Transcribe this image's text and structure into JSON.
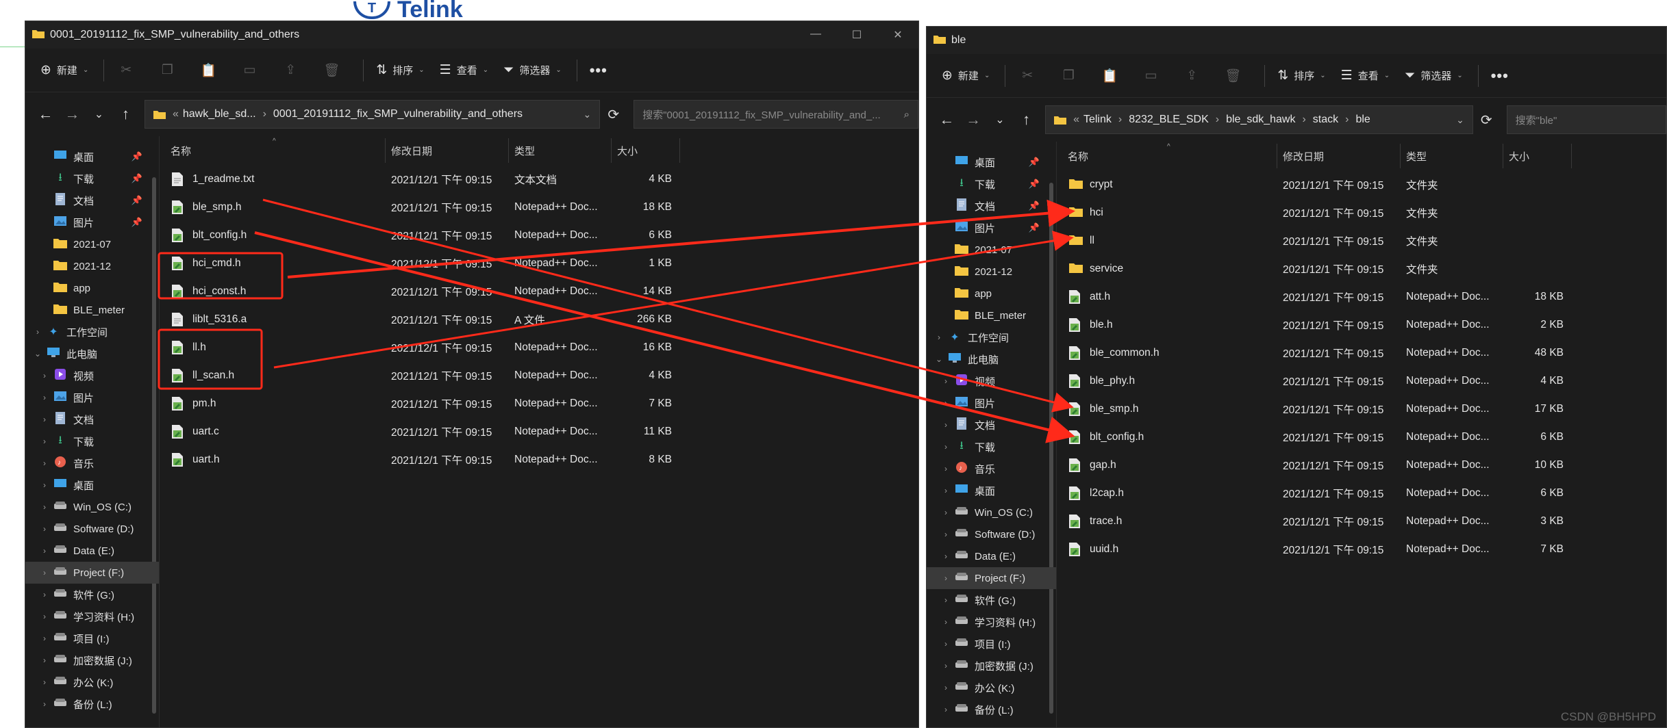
{
  "background": {
    "logo_text": "Telink",
    "logo_letter": "T",
    "watermark": "CSDN @BH5HPD"
  },
  "colors": {
    "window_bg": "#1c1c1c",
    "titlebar_bg": "#202020",
    "annotation_red": "#ff2a1a",
    "folder_yellow": "#f4c542",
    "header_icon_green": "#6ab04c",
    "text": "#e6e6e6"
  },
  "toolbar_labels": {
    "new": "新建",
    "sort": "排序",
    "view": "查看",
    "filter": "筛选器",
    "more": "•••"
  },
  "left_window": {
    "title": "0001_20191112_fix_SMP_vulnerability_and_others",
    "breadcrumb": [
      "hawk_ble_sd...",
      "0001_20191112_fix_SMP_vulnerability_and_others"
    ],
    "search_placeholder": "搜索\"0001_20191112_fix_SMP_vulnerability_and_...",
    "columns": [
      "名称",
      "修改日期",
      "类型",
      "大小"
    ],
    "nav_items": [
      {
        "label": "桌面",
        "icon": "desktop-icon",
        "pinned": true,
        "expander": ""
      },
      {
        "label": "下载",
        "icon": "download-icon",
        "pinned": true,
        "expander": ""
      },
      {
        "label": "文档",
        "icon": "document-icon",
        "pinned": true,
        "expander": ""
      },
      {
        "label": "图片",
        "icon": "picture-icon",
        "pinned": true,
        "expander": ""
      },
      {
        "label": "2021-07",
        "icon": "folder-icon",
        "pinned": false,
        "expander": ""
      },
      {
        "label": "2021-12",
        "icon": "folder-icon",
        "pinned": false,
        "expander": ""
      },
      {
        "label": "app",
        "icon": "folder-icon",
        "pinned": false,
        "expander": ""
      },
      {
        "label": "BLE_meter",
        "icon": "folder-icon",
        "pinned": false,
        "expander": ""
      },
      {
        "label": "工作空间",
        "icon": "workspace-icon",
        "pinned": false,
        "expander": "›",
        "level": 0
      },
      {
        "label": "此电脑",
        "icon": "pc-icon",
        "pinned": false,
        "expander": "⌄",
        "level": 0
      },
      {
        "label": "视频",
        "icon": "video-icon",
        "pinned": false,
        "expander": "›"
      },
      {
        "label": "图片",
        "icon": "picture-icon",
        "pinned": false,
        "expander": "›"
      },
      {
        "label": "文档",
        "icon": "document-icon",
        "pinned": false,
        "expander": "›"
      },
      {
        "label": "下载",
        "icon": "download-icon",
        "pinned": false,
        "expander": "›"
      },
      {
        "label": "音乐",
        "icon": "music-icon",
        "pinned": false,
        "expander": "›"
      },
      {
        "label": "桌面",
        "icon": "desktop-icon",
        "pinned": false,
        "expander": "›"
      },
      {
        "label": "Win_OS (C:)",
        "icon": "drive-icon",
        "pinned": false,
        "expander": "›"
      },
      {
        "label": "Software (D:)",
        "icon": "drive-icon",
        "pinned": false,
        "expander": "›"
      },
      {
        "label": "Data (E:)",
        "icon": "drive-icon",
        "pinned": false,
        "expander": "›"
      },
      {
        "label": "Project (F:)",
        "icon": "drive-icon",
        "pinned": false,
        "expander": "›",
        "selected": true
      },
      {
        "label": "软件 (G:)",
        "icon": "drive-icon",
        "pinned": false,
        "expander": "›"
      },
      {
        "label": "学习资料 (H:)",
        "icon": "drive-icon",
        "pinned": false,
        "expander": "›"
      },
      {
        "label": "项目 (I:)",
        "icon": "drive-icon",
        "pinned": false,
        "expander": "›"
      },
      {
        "label": "加密数据 (J:)",
        "icon": "drive-icon",
        "pinned": false,
        "expander": "›"
      },
      {
        "label": "办公 (K:)",
        "icon": "drive-icon",
        "pinned": false,
        "expander": "›"
      },
      {
        "label": "备份 (L:)",
        "icon": "drive-icon",
        "pinned": false,
        "expander": "›"
      }
    ],
    "files": [
      {
        "name": "1_readme.txt",
        "date": "2021/12/1 下午 09:15",
        "type": "文本文档",
        "size": "4 KB",
        "icon": "text-file-icon"
      },
      {
        "name": "ble_smp.h",
        "date": "2021/12/1 下午 09:15",
        "type": "Notepad++ Doc...",
        "size": "18 KB",
        "icon": "notepad-file-icon"
      },
      {
        "name": "blt_config.h",
        "date": "2021/12/1 下午 09:15",
        "type": "Notepad++ Doc...",
        "size": "6 KB",
        "icon": "notepad-file-icon"
      },
      {
        "name": "hci_cmd.h",
        "date": "2021/12/1 下午 09:15",
        "type": "Notepad++ Doc...",
        "size": "1 KB",
        "icon": "notepad-file-icon"
      },
      {
        "name": "hci_const.h",
        "date": "2021/12/1 下午 09:15",
        "type": "Notepad++ Doc...",
        "size": "14 KB",
        "icon": "notepad-file-icon"
      },
      {
        "name": "liblt_5316.a",
        "date": "2021/12/1 下午 09:15",
        "type": "A 文件",
        "size": "266 KB",
        "icon": "text-file-icon"
      },
      {
        "name": "ll.h",
        "date": "2021/12/1 下午 09:15",
        "type": "Notepad++ Doc...",
        "size": "16 KB",
        "icon": "notepad-file-icon"
      },
      {
        "name": "ll_scan.h",
        "date": "2021/12/1 下午 09:15",
        "type": "Notepad++ Doc...",
        "size": "4 KB",
        "icon": "notepad-file-icon"
      },
      {
        "name": "pm.h",
        "date": "2021/12/1 下午 09:15",
        "type": "Notepad++ Doc...",
        "size": "7 KB",
        "icon": "notepad-file-icon"
      },
      {
        "name": "uart.c",
        "date": "2021/12/1 下午 09:15",
        "type": "Notepad++ Doc...",
        "size": "11 KB",
        "icon": "notepad-file-icon"
      },
      {
        "name": "uart.h",
        "date": "2021/12/1 下午 09:15",
        "type": "Notepad++ Doc...",
        "size": "8 KB",
        "icon": "notepad-file-icon"
      }
    ]
  },
  "right_window": {
    "title": "ble",
    "breadcrumb": [
      "Telink",
      "8232_BLE_SDK",
      "ble_sdk_hawk",
      "stack",
      "ble"
    ],
    "search_placeholder": "搜索\"ble\"",
    "columns": [
      "名称",
      "修改日期",
      "类型",
      "大小"
    ],
    "nav_items": [
      {
        "label": "桌面",
        "icon": "desktop-icon",
        "pinned": true,
        "expander": ""
      },
      {
        "label": "下载",
        "icon": "download-icon",
        "pinned": true,
        "expander": ""
      },
      {
        "label": "文档",
        "icon": "document-icon",
        "pinned": true,
        "expander": ""
      },
      {
        "label": "图片",
        "icon": "picture-icon",
        "pinned": true,
        "expander": ""
      },
      {
        "label": "2021-07",
        "icon": "folder-icon",
        "pinned": false,
        "expander": ""
      },
      {
        "label": "2021-12",
        "icon": "folder-icon",
        "pinned": false,
        "expander": ""
      },
      {
        "label": "app",
        "icon": "folder-icon",
        "pinned": false,
        "expander": ""
      },
      {
        "label": "BLE_meter",
        "icon": "folder-icon",
        "pinned": false,
        "expander": ""
      },
      {
        "label": "工作空间",
        "icon": "workspace-icon",
        "pinned": false,
        "expander": "›",
        "level": 0
      },
      {
        "label": "此电脑",
        "icon": "pc-icon",
        "pinned": false,
        "expander": "⌄",
        "level": 0
      },
      {
        "label": "视频",
        "icon": "video-icon",
        "pinned": false,
        "expander": "›"
      },
      {
        "label": "图片",
        "icon": "picture-icon",
        "pinned": false,
        "expander": "›"
      },
      {
        "label": "文档",
        "icon": "document-icon",
        "pinned": false,
        "expander": "›"
      },
      {
        "label": "下载",
        "icon": "download-icon",
        "pinned": false,
        "expander": "›"
      },
      {
        "label": "音乐",
        "icon": "music-icon",
        "pinned": false,
        "expander": "›"
      },
      {
        "label": "桌面",
        "icon": "desktop-icon",
        "pinned": false,
        "expander": "›"
      },
      {
        "label": "Win_OS (C:)",
        "icon": "drive-icon",
        "pinned": false,
        "expander": "›"
      },
      {
        "label": "Software (D:)",
        "icon": "drive-icon",
        "pinned": false,
        "expander": "›"
      },
      {
        "label": "Data (E:)",
        "icon": "drive-icon",
        "pinned": false,
        "expander": "›"
      },
      {
        "label": "Project (F:)",
        "icon": "drive-icon",
        "pinned": false,
        "expander": "›",
        "selected": true
      },
      {
        "label": "软件 (G:)",
        "icon": "drive-icon",
        "pinned": false,
        "expander": "›"
      },
      {
        "label": "学习资料 (H:)",
        "icon": "drive-icon",
        "pinned": false,
        "expander": "›"
      },
      {
        "label": "项目 (I:)",
        "icon": "drive-icon",
        "pinned": false,
        "expander": "›"
      },
      {
        "label": "加密数据 (J:)",
        "icon": "drive-icon",
        "pinned": false,
        "expander": "›"
      },
      {
        "label": "办公 (K:)",
        "icon": "drive-icon",
        "pinned": false,
        "expander": "›"
      },
      {
        "label": "备份 (L:)",
        "icon": "drive-icon",
        "pinned": false,
        "expander": "›"
      }
    ],
    "files": [
      {
        "name": "crypt",
        "date": "2021/12/1 下午 09:15",
        "type": "文件夹",
        "size": "",
        "icon": "folder-icon"
      },
      {
        "name": "hci",
        "date": "2021/12/1 下午 09:15",
        "type": "文件夹",
        "size": "",
        "icon": "folder-icon"
      },
      {
        "name": "ll",
        "date": "2021/12/1 下午 09:15",
        "type": "文件夹",
        "size": "",
        "icon": "folder-icon"
      },
      {
        "name": "service",
        "date": "2021/12/1 下午 09:15",
        "type": "文件夹",
        "size": "",
        "icon": "folder-icon"
      },
      {
        "name": "att.h",
        "date": "2021/12/1 下午 09:15",
        "type": "Notepad++ Doc...",
        "size": "18 KB",
        "icon": "notepad-file-icon"
      },
      {
        "name": "ble.h",
        "date": "2021/12/1 下午 09:15",
        "type": "Notepad++ Doc...",
        "size": "2 KB",
        "icon": "notepad-file-icon"
      },
      {
        "name": "ble_common.h",
        "date": "2021/12/1 下午 09:15",
        "type": "Notepad++ Doc...",
        "size": "48 KB",
        "icon": "notepad-file-icon"
      },
      {
        "name": "ble_phy.h",
        "date": "2021/12/1 下午 09:15",
        "type": "Notepad++ Doc...",
        "size": "4 KB",
        "icon": "notepad-file-icon"
      },
      {
        "name": "ble_smp.h",
        "date": "2021/12/1 下午 09:15",
        "type": "Notepad++ Doc...",
        "size": "17 KB",
        "icon": "notepad-file-icon"
      },
      {
        "name": "blt_config.h",
        "date": "2021/12/1 下午 09:15",
        "type": "Notepad++ Doc...",
        "size": "6 KB",
        "icon": "notepad-file-icon"
      },
      {
        "name": "gap.h",
        "date": "2021/12/1 下午 09:15",
        "type": "Notepad++ Doc...",
        "size": "10 KB",
        "icon": "notepad-file-icon"
      },
      {
        "name": "l2cap.h",
        "date": "2021/12/1 下午 09:15",
        "type": "Notepad++ Doc...",
        "size": "6 KB",
        "icon": "notepad-file-icon"
      },
      {
        "name": "trace.h",
        "date": "2021/12/1 下午 09:15",
        "type": "Notepad++ Doc...",
        "size": "3 KB",
        "icon": "notepad-file-icon"
      },
      {
        "name": "uuid.h",
        "date": "2021/12/1 下午 09:15",
        "type": "Notepad++ Doc...",
        "size": "7 KB",
        "icon": "notepad-file-icon"
      }
    ]
  }
}
